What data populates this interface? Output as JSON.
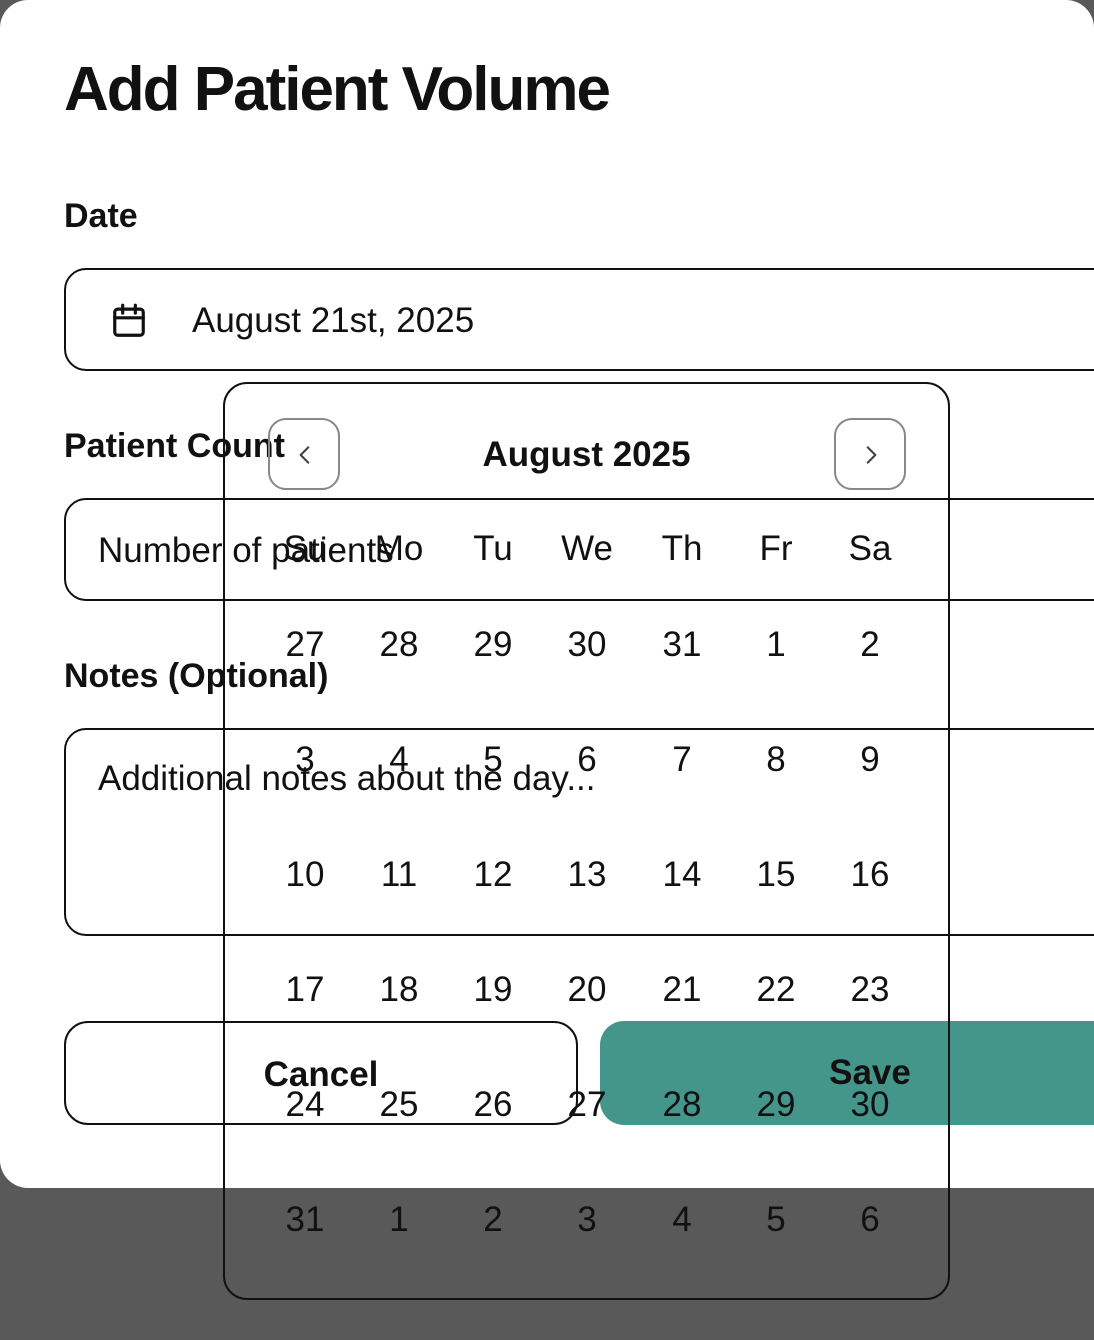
{
  "dialog": {
    "title": "Add Patient Volume",
    "date_label": "Date",
    "date_value": "August 21st, 2025",
    "patient_count_label": "Patient Count",
    "patient_count_placeholder": "Number of patients",
    "notes_label": "Notes (Optional)",
    "notes_placeholder": "Additional notes about the day...",
    "cancel_label": "Cancel",
    "save_label": "Save",
    "accent_color": "#44958a"
  },
  "calendar": {
    "month_title": "August 2025",
    "weekdays": [
      "Su",
      "Mo",
      "Tu",
      "We",
      "Th",
      "Fr",
      "Sa"
    ],
    "weeks": [
      [
        "27",
        "28",
        "29",
        "30",
        "31",
        "1",
        "2"
      ],
      [
        "3",
        "4",
        "5",
        "6",
        "7",
        "8",
        "9"
      ],
      [
        "10",
        "11",
        "12",
        "13",
        "14",
        "15",
        "16"
      ],
      [
        "17",
        "18",
        "19",
        "20",
        "21",
        "22",
        "23"
      ],
      [
        "24",
        "25",
        "26",
        "27",
        "28",
        "29",
        "30"
      ],
      [
        "31",
        "1",
        "2",
        "3",
        "4",
        "5",
        "6"
      ]
    ],
    "prev_icon": "chevron-left-icon",
    "next_icon": "chevron-right-icon"
  }
}
